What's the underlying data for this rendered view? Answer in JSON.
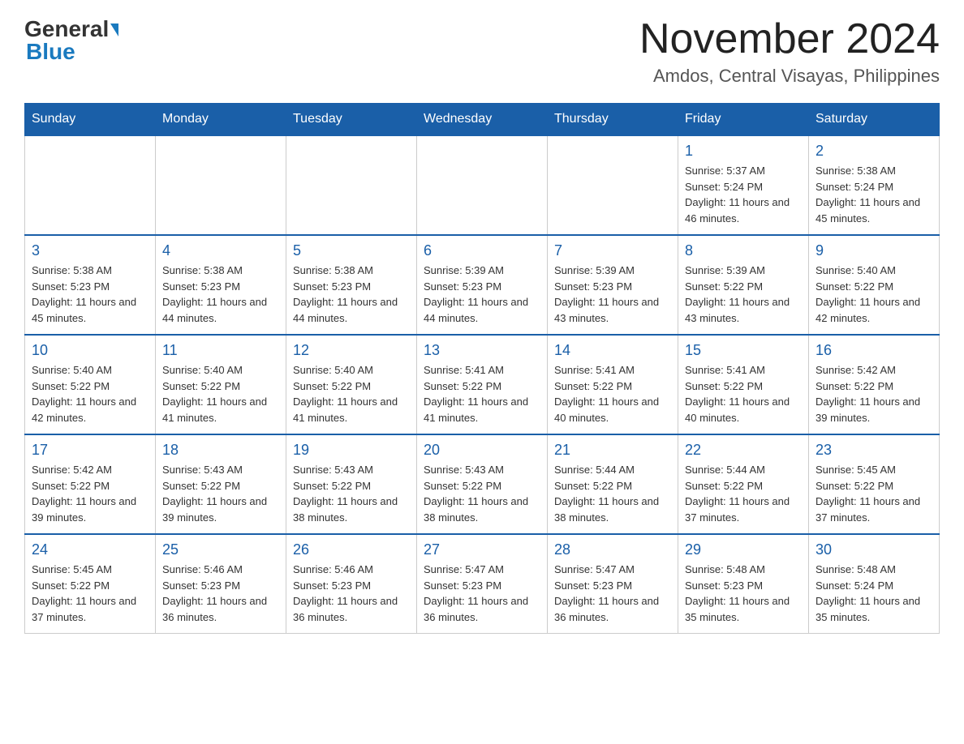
{
  "header": {
    "logo": {
      "general": "General",
      "blue": "Blue"
    },
    "title": "November 2024",
    "subtitle": "Amdos, Central Visayas, Philippines"
  },
  "calendar": {
    "days_of_week": [
      "Sunday",
      "Monday",
      "Tuesday",
      "Wednesday",
      "Thursday",
      "Friday",
      "Saturday"
    ],
    "weeks": [
      {
        "days": [
          {
            "number": "",
            "info": "",
            "empty": true
          },
          {
            "number": "",
            "info": "",
            "empty": true
          },
          {
            "number": "",
            "info": "",
            "empty": true
          },
          {
            "number": "",
            "info": "",
            "empty": true
          },
          {
            "number": "",
            "info": "",
            "empty": true
          },
          {
            "number": "1",
            "info": "Sunrise: 5:37 AM\nSunset: 5:24 PM\nDaylight: 11 hours and 46 minutes."
          },
          {
            "number": "2",
            "info": "Sunrise: 5:38 AM\nSunset: 5:24 PM\nDaylight: 11 hours and 45 minutes."
          }
        ]
      },
      {
        "days": [
          {
            "number": "3",
            "info": "Sunrise: 5:38 AM\nSunset: 5:23 PM\nDaylight: 11 hours and 45 minutes."
          },
          {
            "number": "4",
            "info": "Sunrise: 5:38 AM\nSunset: 5:23 PM\nDaylight: 11 hours and 44 minutes."
          },
          {
            "number": "5",
            "info": "Sunrise: 5:38 AM\nSunset: 5:23 PM\nDaylight: 11 hours and 44 minutes."
          },
          {
            "number": "6",
            "info": "Sunrise: 5:39 AM\nSunset: 5:23 PM\nDaylight: 11 hours and 44 minutes."
          },
          {
            "number": "7",
            "info": "Sunrise: 5:39 AM\nSunset: 5:23 PM\nDaylight: 11 hours and 43 minutes."
          },
          {
            "number": "8",
            "info": "Sunrise: 5:39 AM\nSunset: 5:22 PM\nDaylight: 11 hours and 43 minutes."
          },
          {
            "number": "9",
            "info": "Sunrise: 5:40 AM\nSunset: 5:22 PM\nDaylight: 11 hours and 42 minutes."
          }
        ]
      },
      {
        "days": [
          {
            "number": "10",
            "info": "Sunrise: 5:40 AM\nSunset: 5:22 PM\nDaylight: 11 hours and 42 minutes."
          },
          {
            "number": "11",
            "info": "Sunrise: 5:40 AM\nSunset: 5:22 PM\nDaylight: 11 hours and 41 minutes."
          },
          {
            "number": "12",
            "info": "Sunrise: 5:40 AM\nSunset: 5:22 PM\nDaylight: 11 hours and 41 minutes."
          },
          {
            "number": "13",
            "info": "Sunrise: 5:41 AM\nSunset: 5:22 PM\nDaylight: 11 hours and 41 minutes."
          },
          {
            "number": "14",
            "info": "Sunrise: 5:41 AM\nSunset: 5:22 PM\nDaylight: 11 hours and 40 minutes."
          },
          {
            "number": "15",
            "info": "Sunrise: 5:41 AM\nSunset: 5:22 PM\nDaylight: 11 hours and 40 minutes."
          },
          {
            "number": "16",
            "info": "Sunrise: 5:42 AM\nSunset: 5:22 PM\nDaylight: 11 hours and 39 minutes."
          }
        ]
      },
      {
        "days": [
          {
            "number": "17",
            "info": "Sunrise: 5:42 AM\nSunset: 5:22 PM\nDaylight: 11 hours and 39 minutes."
          },
          {
            "number": "18",
            "info": "Sunrise: 5:43 AM\nSunset: 5:22 PM\nDaylight: 11 hours and 39 minutes."
          },
          {
            "number": "19",
            "info": "Sunrise: 5:43 AM\nSunset: 5:22 PM\nDaylight: 11 hours and 38 minutes."
          },
          {
            "number": "20",
            "info": "Sunrise: 5:43 AM\nSunset: 5:22 PM\nDaylight: 11 hours and 38 minutes."
          },
          {
            "number": "21",
            "info": "Sunrise: 5:44 AM\nSunset: 5:22 PM\nDaylight: 11 hours and 38 minutes."
          },
          {
            "number": "22",
            "info": "Sunrise: 5:44 AM\nSunset: 5:22 PM\nDaylight: 11 hours and 37 minutes."
          },
          {
            "number": "23",
            "info": "Sunrise: 5:45 AM\nSunset: 5:22 PM\nDaylight: 11 hours and 37 minutes."
          }
        ]
      },
      {
        "days": [
          {
            "number": "24",
            "info": "Sunrise: 5:45 AM\nSunset: 5:22 PM\nDaylight: 11 hours and 37 minutes."
          },
          {
            "number": "25",
            "info": "Sunrise: 5:46 AM\nSunset: 5:23 PM\nDaylight: 11 hours and 36 minutes."
          },
          {
            "number": "26",
            "info": "Sunrise: 5:46 AM\nSunset: 5:23 PM\nDaylight: 11 hours and 36 minutes."
          },
          {
            "number": "27",
            "info": "Sunrise: 5:47 AM\nSunset: 5:23 PM\nDaylight: 11 hours and 36 minutes."
          },
          {
            "number": "28",
            "info": "Sunrise: 5:47 AM\nSunset: 5:23 PM\nDaylight: 11 hours and 36 minutes."
          },
          {
            "number": "29",
            "info": "Sunrise: 5:48 AM\nSunset: 5:23 PM\nDaylight: 11 hours and 35 minutes."
          },
          {
            "number": "30",
            "info": "Sunrise: 5:48 AM\nSunset: 5:24 PM\nDaylight: 11 hours and 35 minutes."
          }
        ]
      }
    ]
  }
}
